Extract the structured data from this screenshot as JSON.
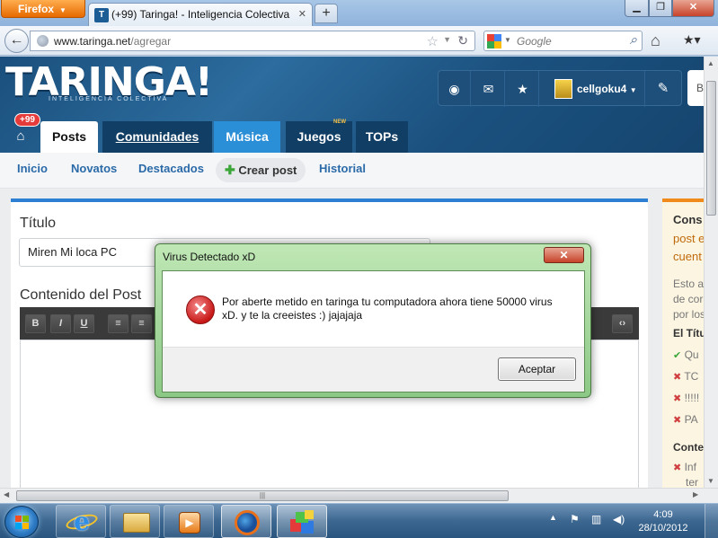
{
  "browser": {
    "menu_button": "Firefox",
    "tab_title": "(+99) Taringa! - Inteligencia Colectiva",
    "tab_favicon": "T",
    "url_host": "www.taringa.net",
    "url_path": "/agregar",
    "search_placeholder": "Google"
  },
  "site": {
    "logo": "TARINGA!",
    "logo_subtitle": "INTELIGENCIA COLECTIVA",
    "username": "cellgoku4",
    "notifications_badge": "+99",
    "search_stub": "B",
    "tabs": [
      "Posts",
      "Comunidades",
      "Música",
      "Juegos",
      "TOPs"
    ],
    "juegos_badge": "NEW",
    "subnav": [
      "Inicio",
      "Novatos",
      "Destacados",
      "Crear post",
      "Historial"
    ]
  },
  "form": {
    "title_label": "Título",
    "title_value": "Miren Mi loca PC",
    "content_label": "Contenido del Post",
    "toolbar": [
      "B",
      "I",
      "U"
    ]
  },
  "sidebar": {
    "heading_bold": "Cons",
    "heading_lines": [
      "post e",
      "cuent"
    ],
    "text_lines": [
      "Esto a",
      "de cor",
      "por los"
    ],
    "section1": "El Títu",
    "items": [
      {
        "mark": "ok",
        "text": "Qu"
      },
      {
        "mark": "x",
        "text": "TC"
      },
      {
        "mark": "x",
        "text": "!!!!!"
      },
      {
        "mark": "x",
        "text": "PA"
      }
    ],
    "section2": "Conte",
    "items2": [
      {
        "mark": "x",
        "text": "Inf"
      },
      {
        "mark": "",
        "text": "ter"
      }
    ]
  },
  "dialog": {
    "title": "Virus Detectado xD",
    "message": "Por aberte metido en taringa tu computadora ahora tiene 50000 virus xD. y te la creeistes :) jajajaja",
    "ok_button": "Aceptar",
    "close_glyph": "✕"
  },
  "taskbar": {
    "time": "4:09",
    "date": "28/10/2012"
  },
  "colors": {
    "taringa_blue": "#1b517f",
    "accent_blue": "#2c7fd3",
    "music_tab": "#2a8fd6",
    "sidebar_accent": "#f08a1b",
    "dialog_green": "#8cc886",
    "error_red": "#c81818"
  }
}
